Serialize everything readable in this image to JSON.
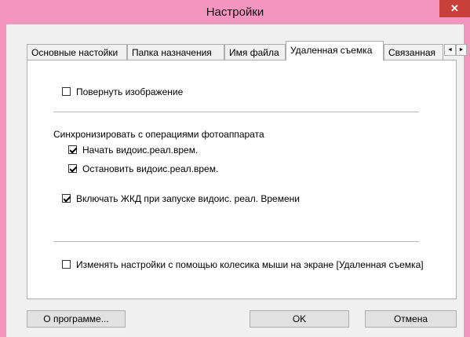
{
  "window": {
    "title": "Настройки",
    "close_glyph": "✕"
  },
  "tabs": [
    {
      "label": "Основные настойки",
      "active": false
    },
    {
      "label": "Папка назначения",
      "active": false
    },
    {
      "label": "Имя файла",
      "active": false
    },
    {
      "label": "Удаленная съемка",
      "active": true
    },
    {
      "label": "Связанная",
      "active": false
    }
  ],
  "tab_scroll": {
    "left_glyph": "◄",
    "right_glyph": "►"
  },
  "settings": {
    "rotate_image": {
      "label": "Повернуть изображение",
      "checked": false
    },
    "sync_heading": "Синхронизировать с операциями фотоаппарата",
    "start_live_view": {
      "label": "Начать видоис.реал.врем.",
      "checked": true
    },
    "stop_live_view": {
      "label": "Остановить видоис.реал.врем.",
      "checked": true
    },
    "lcd_on_live_view": {
      "label": "Включать ЖКД при запуске видоис. реал. Времени",
      "checked": true
    },
    "mouse_wheel": {
      "label": "Изменять настройки с помощью колесика мыши на экране [Удаленная съемка]",
      "checked": false
    }
  },
  "buttons": {
    "about": "О программе...",
    "ok": "OK",
    "cancel": "Отмена"
  }
}
